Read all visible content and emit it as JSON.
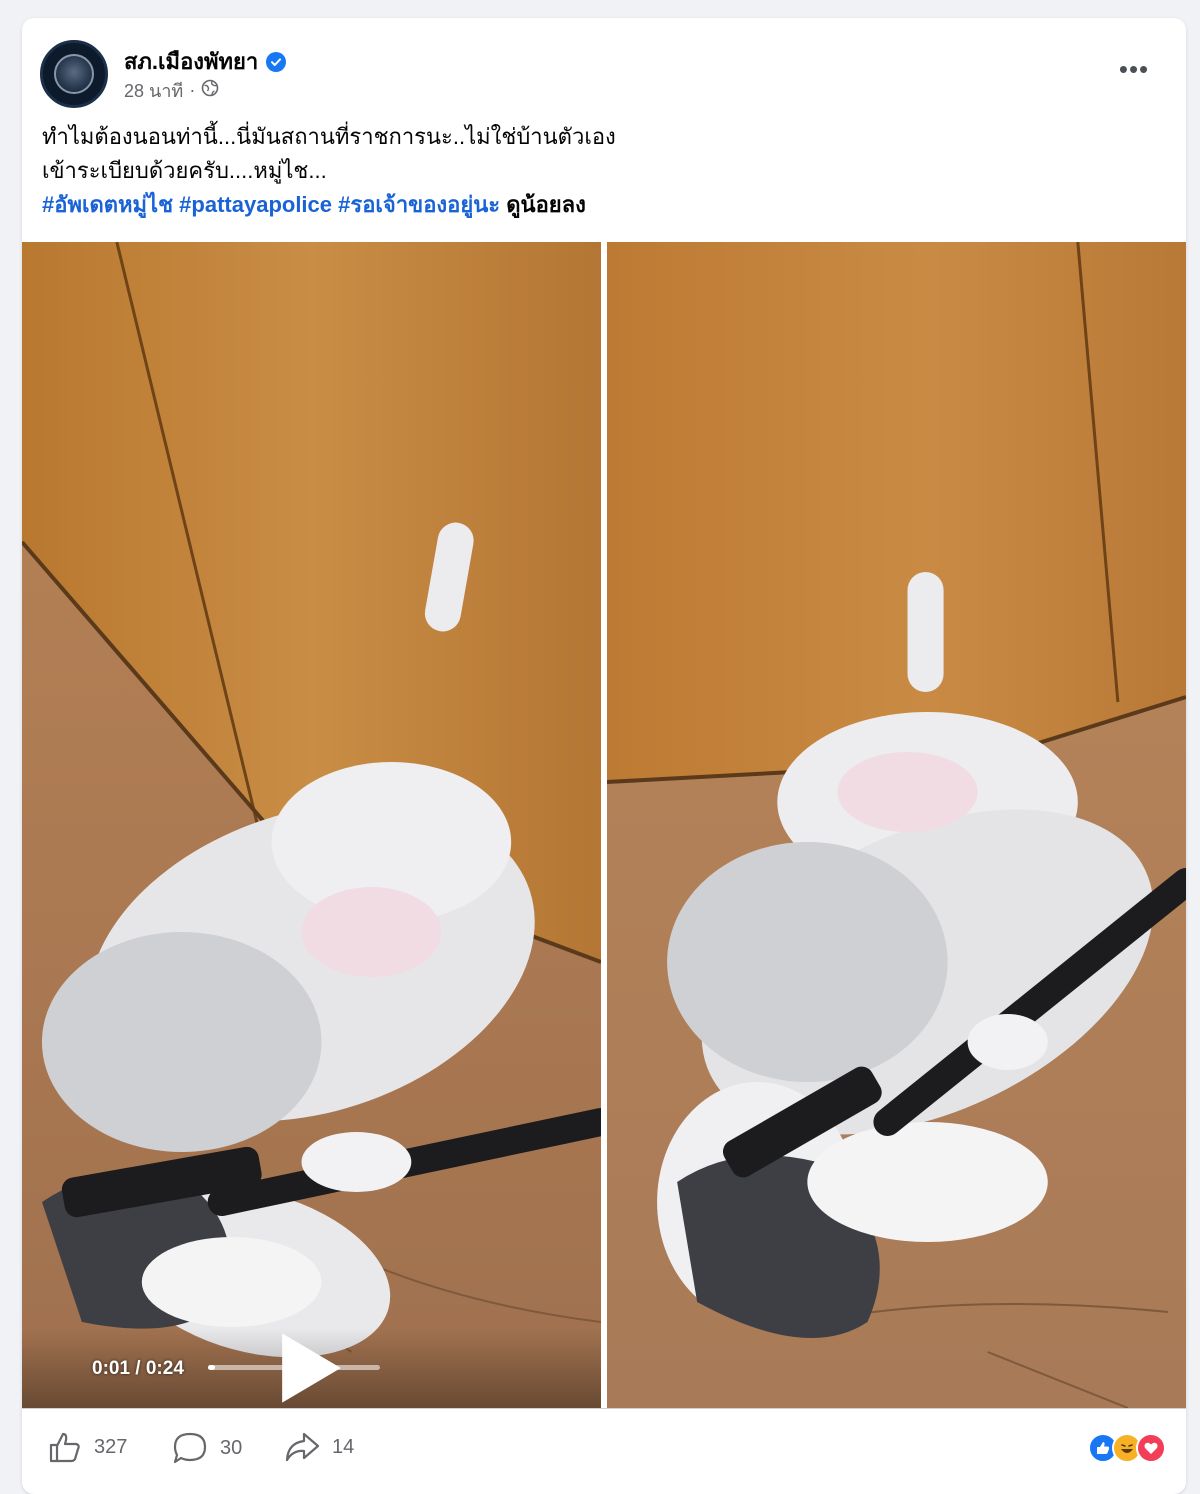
{
  "post": {
    "page_name": "สภ.เมืองพัทยา",
    "time": "28 นาที",
    "separator": "·",
    "more": "•••",
    "text_line1": "ทำไมต้องนอนท่านี้...นี่มันสถานที่ราชการนะ..ไม่ใช่บ้านตัวเอง",
    "text_line2": "เข้าระเบียบด้วยครับ....หมู่ไช...",
    "hashtags": [
      "#อัพเดตหมู่ไช",
      "#pattayapolice",
      "#รอเจ้าของอยู่นะ"
    ],
    "trailing": "ดูน้อยลง"
  },
  "video": {
    "time": "0:01 / 0:24",
    "progress": 0.04
  },
  "engagement": {
    "likes": "327",
    "comments": "30",
    "shares": "14"
  },
  "icons": {
    "verified": "verified-badge-icon",
    "privacy": "globe-icon",
    "like": "thumbs-up-icon",
    "comment": "comment-icon",
    "share": "share-icon"
  },
  "colors": {
    "accent": "#1877f2",
    "hashtag": "#1a63d6",
    "love": "#f33e58",
    "haha": "#f7b125"
  }
}
